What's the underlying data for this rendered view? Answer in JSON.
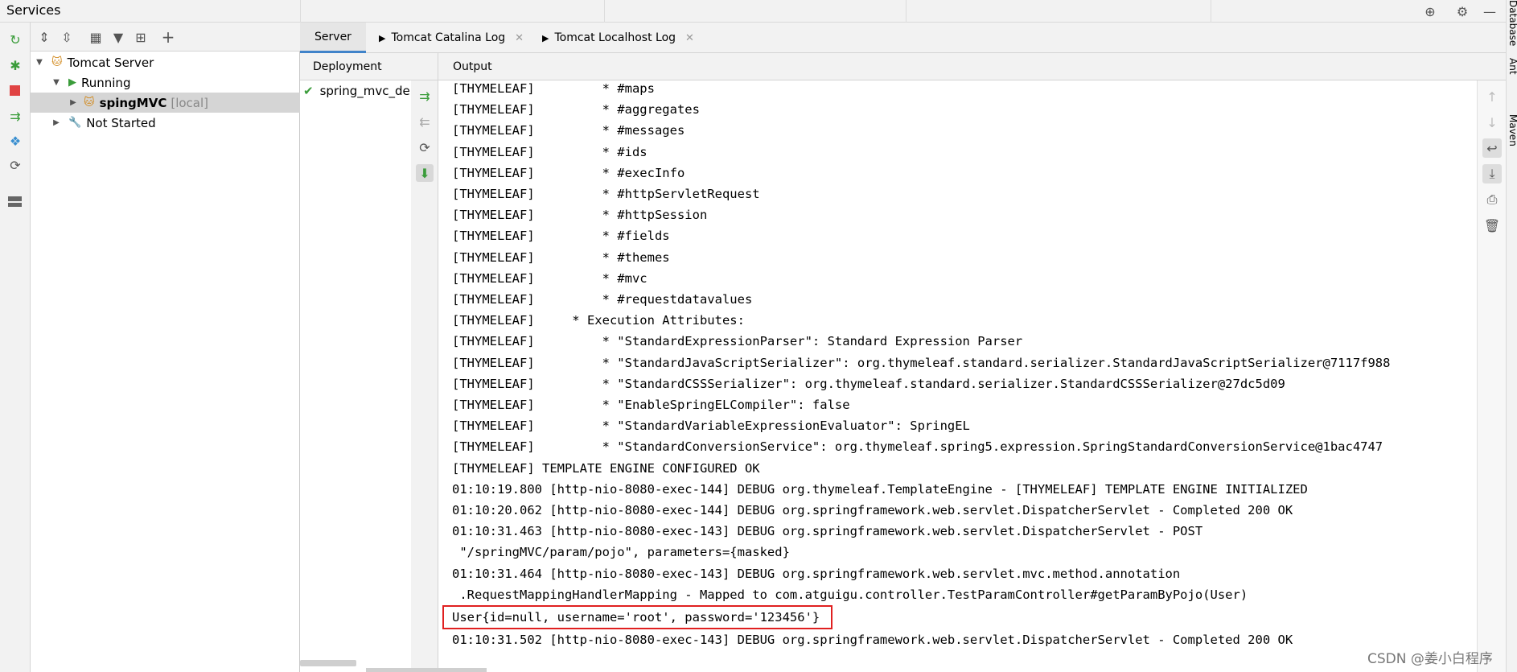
{
  "window": {
    "title": "Services"
  },
  "side_tools": [
    "Database",
    "Ant",
    "Maven"
  ],
  "tree": {
    "root": "Tomcat Server",
    "running": "Running",
    "app_name": "spingMVC",
    "app_tag": "[local]",
    "not_started": "Not Started"
  },
  "tabs": [
    "Server",
    "Tomcat Catalina Log",
    "Tomcat Localhost Log"
  ],
  "deployment": {
    "header": "Deployment",
    "item": "spring_mvc_de"
  },
  "output": {
    "header": "Output",
    "lines": [
      "[THYMELEAF]         * #maps",
      "[THYMELEAF]         * #aggregates",
      "[THYMELEAF]         * #messages",
      "[THYMELEAF]         * #ids",
      "[THYMELEAF]         * #execInfo",
      "[THYMELEAF]         * #httpServletRequest",
      "[THYMELEAF]         * #httpSession",
      "[THYMELEAF]         * #fields",
      "[THYMELEAF]         * #themes",
      "[THYMELEAF]         * #mvc",
      "[THYMELEAF]         * #requestdatavalues",
      "[THYMELEAF]     * Execution Attributes:",
      "[THYMELEAF]         * \"StandardExpressionParser\": Standard Expression Parser",
      "[THYMELEAF]         * \"StandardJavaScriptSerializer\": org.thymeleaf.standard.serializer.StandardJavaScriptSerializer@7117f988",
      "[THYMELEAF]         * \"StandardCSSSerializer\": org.thymeleaf.standard.serializer.StandardCSSSerializer@27dc5d09",
      "[THYMELEAF]         * \"EnableSpringELCompiler\": false",
      "[THYMELEAF]         * \"StandardVariableExpressionEvaluator\": SpringEL",
      "[THYMELEAF]         * \"StandardConversionService\": org.thymeleaf.spring5.expression.SpringStandardConversionService@1bac4747",
      "[THYMELEAF] TEMPLATE ENGINE CONFIGURED OK",
      "01:10:19.800 [http-nio-8080-exec-144] DEBUG org.thymeleaf.TemplateEngine - [THYMELEAF] TEMPLATE ENGINE INITIALIZED",
      "01:10:20.062 [http-nio-8080-exec-144] DEBUG org.springframework.web.servlet.DispatcherServlet - Completed 200 OK",
      "01:10:31.463 [http-nio-8080-exec-143] DEBUG org.springframework.web.servlet.DispatcherServlet - POST",
      " \"/springMVC/param/pojo\", parameters={masked}",
      "01:10:31.464 [http-nio-8080-exec-143] DEBUG org.springframework.web.servlet.mvc.method.annotation",
      " .RequestMappingHandlerMapping - Mapped to com.atguigu.controller.TestParamController#getParamByPojo(User)",
      "User{id=null, username='root', password='123456'}",
      "01:10:31.502 [http-nio-8080-exec-143] DEBUG org.springframework.web.servlet.DispatcherServlet - Completed 200 OK"
    ],
    "highlight_index": 25,
    "highlight_color": "#e02020"
  },
  "watermark": "CSDN @姜小白程序"
}
